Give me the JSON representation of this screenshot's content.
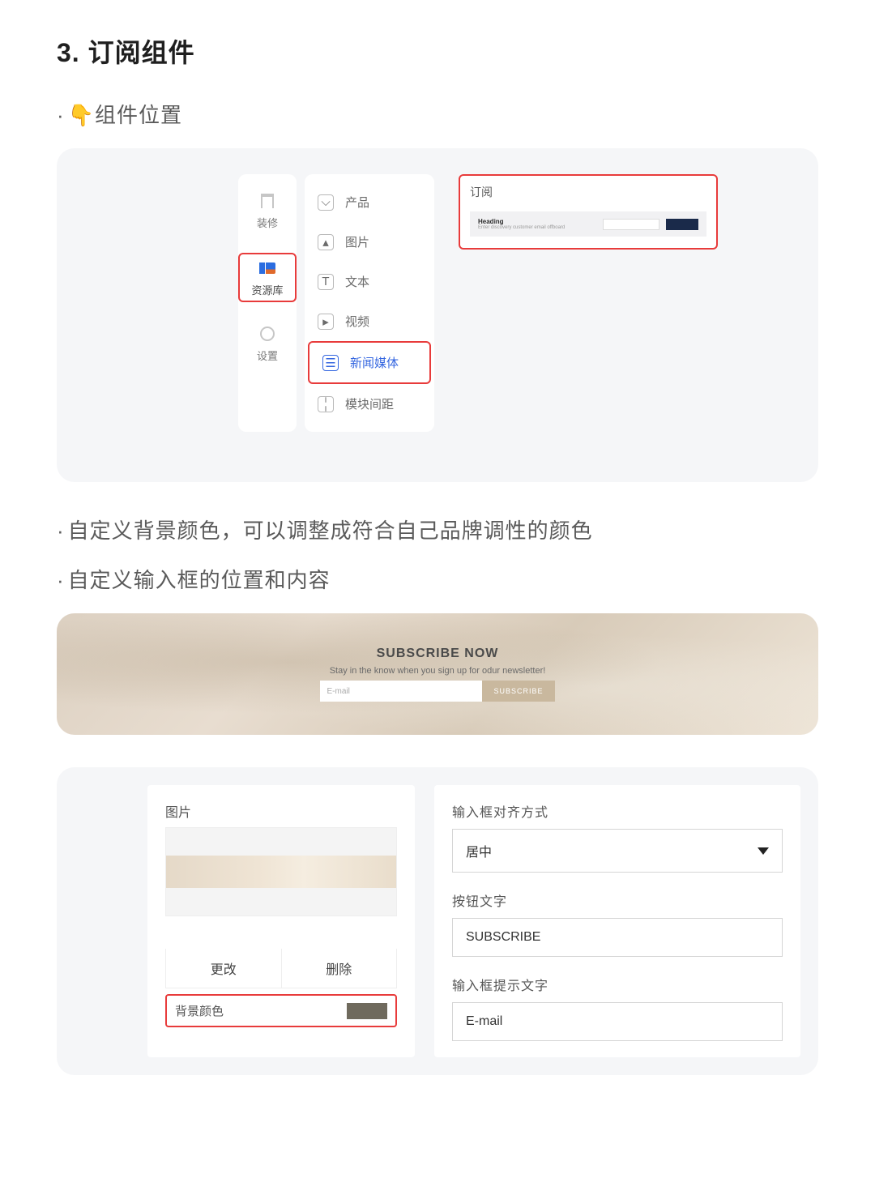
{
  "heading": "3. 订阅组件",
  "bullets": {
    "b1": "组件位置",
    "b2": "自定义背景颜色，可以调整成符合自己品牌调性的颜色",
    "b3": "自定义输入框的位置和内容"
  },
  "shot1": {
    "rail": {
      "decor": "装修",
      "resources": "资源库",
      "settings": "设置"
    },
    "categories": {
      "product": "产品",
      "image": "图片",
      "text": "文本",
      "video": "视频",
      "news": "新闻媒体",
      "spacer": "模块间距"
    },
    "preview": {
      "title": "订阅",
      "heading": "Heading",
      "sub": "Enter discovery customer email offboard"
    }
  },
  "shot2": {
    "title": "SUBSCRIBE NOW",
    "desc": "Stay in the know when you sign up for odur newsletter!",
    "placeholder": "E-mail",
    "button": "SUBSCRIBE"
  },
  "shot3": {
    "left": {
      "image_label": "图片",
      "change": "更改",
      "delete": "删除",
      "bgcolor_label": "背景颜色",
      "bgcolor_value": "#6f6a5d"
    },
    "right": {
      "align_label": "输入框对齐方式",
      "align_value": "居中",
      "btn_text_label": "按钮文字",
      "btn_text_value": "SUBSCRIBE",
      "placeholder_label": "输入框提示文字",
      "placeholder_value": "E-mail"
    }
  }
}
